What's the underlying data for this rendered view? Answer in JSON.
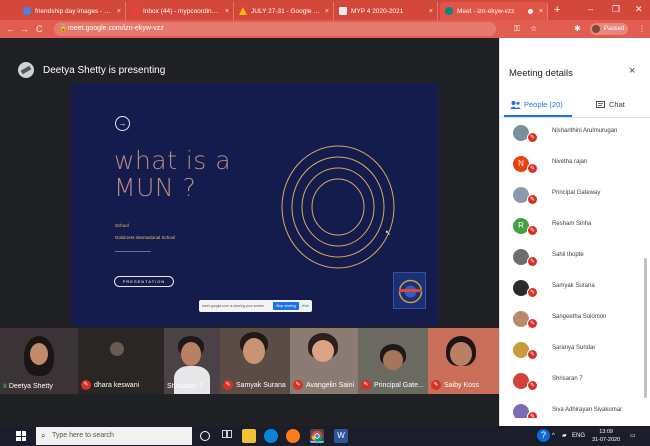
{
  "browser": {
    "tabs": [
      {
        "title": "friendship day images - Goog",
        "favicon_color": "#4285f4"
      },
      {
        "title": "Inbox (44) - mypcoordinator@",
        "favicon_color": "#ea4335"
      },
      {
        "title": "JULY 27-31 - Google Drive",
        "favicon_color": "#fbbc05"
      },
      {
        "title": "MYP 4 2020-2021",
        "favicon_color": "#3c4043"
      },
      {
        "title": "Meet - izn-ekyw-vzz",
        "favicon_color": "#00897b",
        "active": true
      }
    ],
    "tab_close": "×",
    "new_tab": "+",
    "window_controls": {
      "minimize": "–",
      "maximize": "❐",
      "close": "✕"
    },
    "nav": {
      "back": "←",
      "forward": "→",
      "reload": "C"
    },
    "url": "meet.google.com/izn-ekyw-vzz",
    "toolbar_icons": {
      "key": "⚿",
      "star": "☆",
      "puzzle": "✱",
      "menu": "⋮",
      "lock": "🔒"
    },
    "profile_status": "Paused"
  },
  "meet": {
    "presenter_text": "Deetya Shetty is presenting",
    "slide": {
      "arrow": "→",
      "headline_line1": "what is a",
      "headline_line2": "MUN ?",
      "school_label": "School",
      "school_name": "Goldcrest International School",
      "button_label": "PRESENTATION"
    },
    "share_bar": {
      "message": "meet.google.com is sharing your screen",
      "stop_label": "Stop sharing",
      "hide_label": "Hide"
    },
    "participants": [
      {
        "name": "Deetya Shetty",
        "muted": false
      },
      {
        "name": "dhara keswani",
        "muted": true
      },
      {
        "name": "Shrisaran 7",
        "muted": false
      },
      {
        "name": "Samyak Surana",
        "muted": true
      },
      {
        "name": "Avangelin Saini",
        "muted": true
      },
      {
        "name": "Principal Gate...",
        "muted": true
      },
      {
        "name": "Saiby Koss",
        "muted": true
      }
    ]
  },
  "panel": {
    "title": "Meeting details",
    "close": "×",
    "people_tab": "People (20)",
    "chat_tab": "Chat",
    "people": [
      {
        "name": "Nishanthini Arulmurugan",
        "initial": "",
        "color": "#7a8f9b"
      },
      {
        "name": "Nivetha rajan",
        "initial": "N",
        "color": "#e8430c"
      },
      {
        "name": "Principal Gateway",
        "initial": "",
        "color": "#8a9aa8"
      },
      {
        "name": "Resham Sinha",
        "initial": "R",
        "color": "#43a047"
      },
      {
        "name": "Sahil thopte",
        "initial": "",
        "color": "#6d6d6d"
      },
      {
        "name": "Samyak Surana",
        "initial": "",
        "color": "#2b2b2b"
      },
      {
        "name": "Sangeetha Solomon",
        "initial": "",
        "color": "#b88a6a"
      },
      {
        "name": "Saranya Sundar",
        "initial": "",
        "color": "#c89b3c"
      },
      {
        "name": "Shrisaran 7",
        "initial": "",
        "color": "#d2423a"
      },
      {
        "name": "Siva Adhirayan Sivakumar",
        "initial": "",
        "color": "#7c6bb0"
      }
    ],
    "mute_glyph": "✎"
  },
  "taskbar": {
    "search_placeholder": "Type here to search",
    "search_icon": "⌕",
    "tray_lang": "ENG",
    "tray_arrow": "^",
    "time": "13:09",
    "date": "31-07-2020",
    "help": "?"
  }
}
